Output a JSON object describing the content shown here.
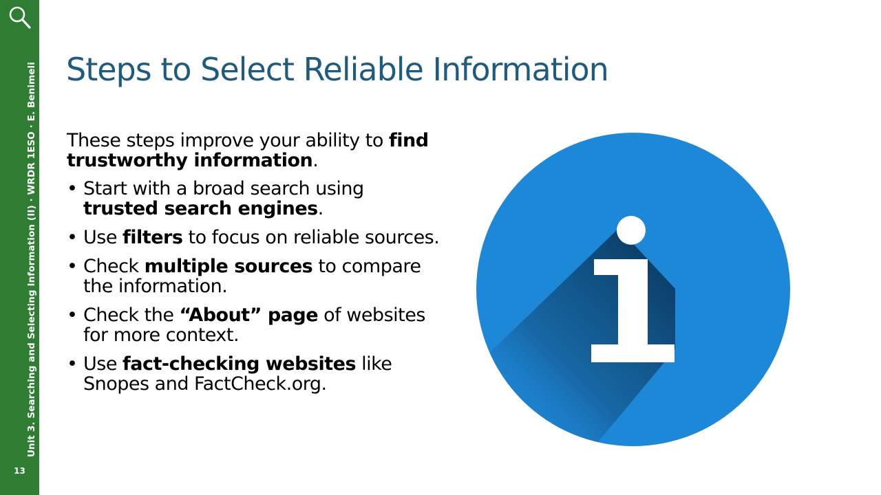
{
  "sidebar": {
    "icon": "search-icon",
    "vertical_text": "Unit 3. Searching and Selecting Information (II) · WRDR 1ESO · E. Benimeli",
    "page_number": "13",
    "color": "#2e7d32"
  },
  "slide": {
    "title": "Steps to Select Reliable Information",
    "title_color": "#1e5b7e",
    "intro": {
      "text": "These steps improve your ability to ",
      "bold": "find trustworthy information",
      "end": "."
    },
    "bullets": [
      {
        "pre": "Start with a broad search using ",
        "bold": "trusted search engines",
        "post": "."
      },
      {
        "pre": "Use ",
        "bold": "filters",
        "post": " to focus on reliable sources."
      },
      {
        "pre": "Check ",
        "bold": "multiple sources",
        "post": " to compare the information."
      },
      {
        "pre": "Check the ",
        "bold": "“About” page",
        "post": " of websites for more context."
      },
      {
        "pre": "Use ",
        "bold": "fact-checking websites",
        "post": " like Snopes and FactCheck.org."
      }
    ],
    "bullet_glyph": "•",
    "graphic": {
      "icon": "info-icon",
      "circle_color": "#1e88d8",
      "letter": "i"
    }
  }
}
